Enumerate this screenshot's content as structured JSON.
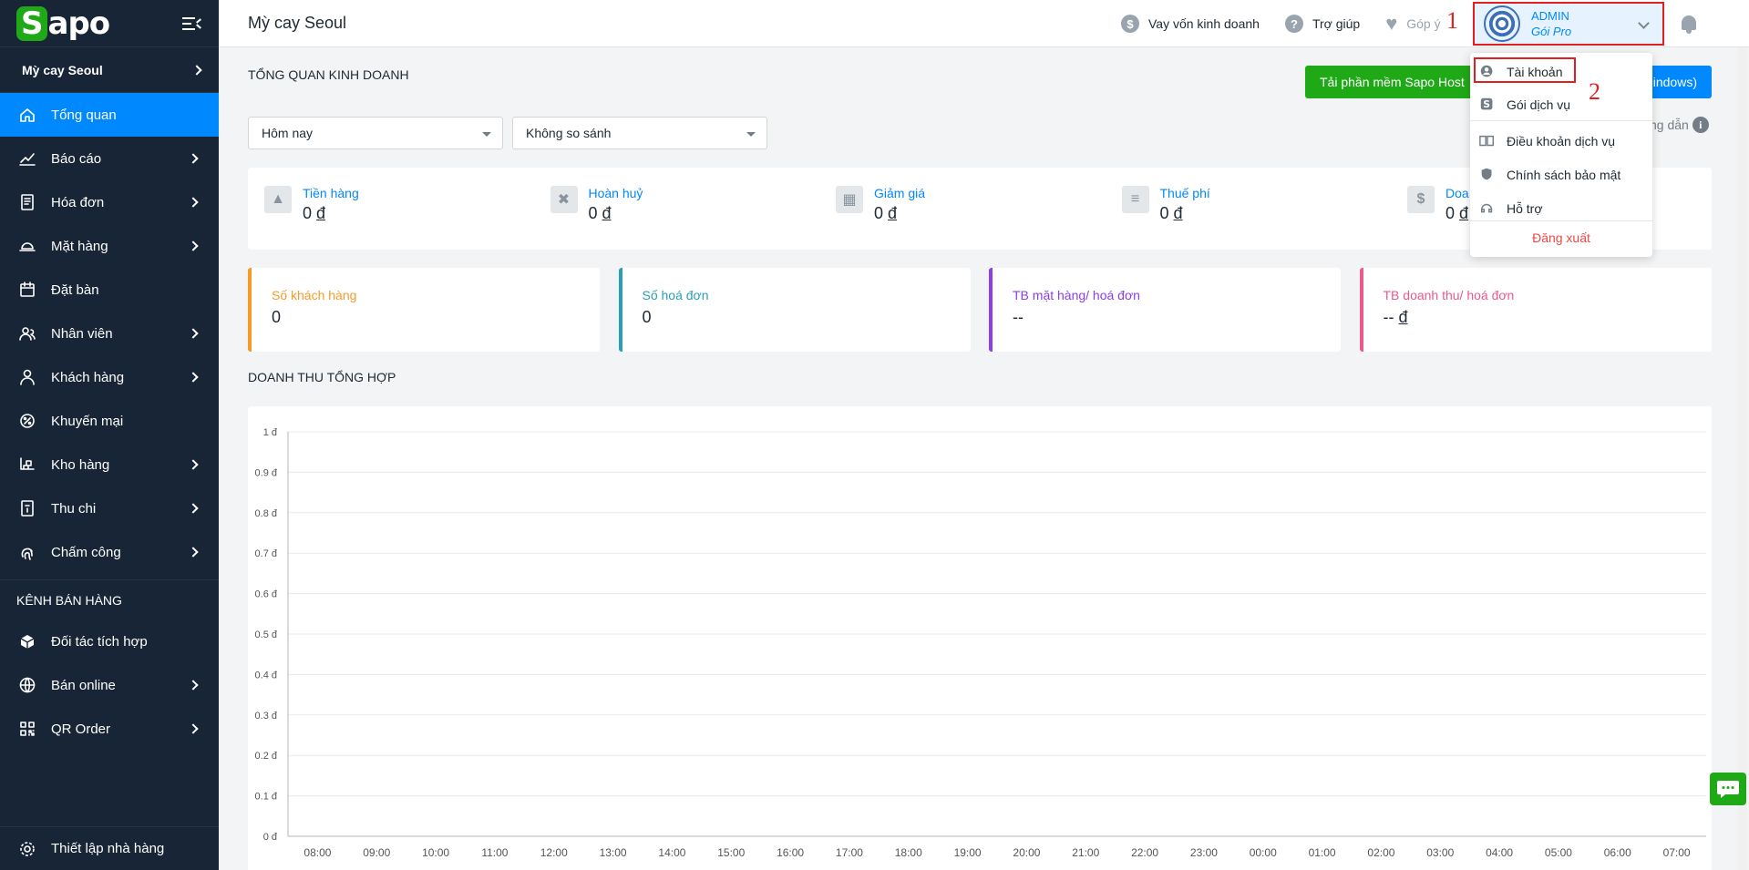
{
  "brand": {
    "logo_letter": "S",
    "logo_rest": "apo"
  },
  "sidebar": {
    "store": "Mỳ cay Seoul",
    "items": [
      {
        "label": "Tổng quan",
        "icon": "home-icon",
        "active": true,
        "arrow": false
      },
      {
        "label": "Báo cáo",
        "icon": "chart-line-icon",
        "arrow": true
      },
      {
        "label": "Hóa đơn",
        "icon": "receipt-icon",
        "arrow": true
      },
      {
        "label": "Mặt hàng",
        "icon": "dish-icon",
        "arrow": true
      },
      {
        "label": "Đặt bàn",
        "icon": "calendar-icon",
        "arrow": false
      },
      {
        "label": "Nhân viên",
        "icon": "staff-icon",
        "arrow": true
      },
      {
        "label": "Khách hàng",
        "icon": "customer-icon",
        "arrow": true
      },
      {
        "label": "Khuyến mại",
        "icon": "promotion-icon",
        "arrow": false
      },
      {
        "label": "Kho hàng",
        "icon": "warehouse-icon",
        "arrow": true
      },
      {
        "label": "Thu chi",
        "icon": "cashbook-icon",
        "arrow": true
      },
      {
        "label": "Chấm công",
        "icon": "fingerprint-icon",
        "arrow": true
      }
    ],
    "section_label": "KÊNH BÁN HÀNG",
    "channel_items": [
      {
        "label": "Đối tác tích hợp",
        "icon": "partner-icon",
        "arrow": false
      },
      {
        "label": "Bán online",
        "icon": "globe-icon",
        "arrow": true
      },
      {
        "label": "QR Order",
        "icon": "qr-icon",
        "arrow": true
      }
    ],
    "bottom": "Thiết lập nhà hàng"
  },
  "topbar": {
    "store": "Mỳ cay Seoul",
    "loan": "Vay vốn kinh doanh",
    "help": "Trợ giúp",
    "feedback": "Góp ý",
    "admin_name": "ADMIN",
    "admin_plan": "Gói Pro"
  },
  "annotations": {
    "marker1": "1",
    "marker2": "2"
  },
  "main": {
    "overview_title": "TỔNG QUAN KINH DOANH",
    "download_btn": "Tải phần mềm Sapo Host",
    "download_btn2": "indows)",
    "guide": "ng dẫn",
    "period": "Hôm nay",
    "compare": "Không so sánh",
    "stats": [
      {
        "label": "Tiền hàng",
        "value": "0",
        "icon": "tray-icon"
      },
      {
        "label": "Hoàn huỷ",
        "value": "0",
        "icon": "trash-icon"
      },
      {
        "label": "Giảm giá",
        "value": "0",
        "icon": "gift-icon"
      },
      {
        "label": "Thuế phí",
        "value": "0",
        "icon": "tax-icon"
      },
      {
        "label": "Doa",
        "value": "0",
        "icon": "dollar-icon"
      }
    ],
    "currency": "đ",
    "kpis": [
      {
        "label": "Số khách hàng",
        "value": "0",
        "color": "#f59b27"
      },
      {
        "label": "Số hoá đơn",
        "value": "0",
        "color": "#29a0b7"
      },
      {
        "label": "TB mặt hàng/ hoá đơn",
        "value": "--",
        "color": "#8c3fe6"
      },
      {
        "label": "TB doanh thu/ hoá đơn",
        "value": "--",
        "color": "#ec5a8c"
      }
    ],
    "revenue_title": "DOANH THU TỔNG HỢP"
  },
  "dropdown": {
    "items": [
      {
        "label": "Tài khoản",
        "icon": "user-circle-icon"
      },
      {
        "label": "Gói dịch vụ",
        "icon": "sapo-s-icon"
      },
      {
        "label": "Điều khoản dịch vụ",
        "icon": "book-icon"
      },
      {
        "label": "Chính sách bảo mật",
        "icon": "shield-icon"
      },
      {
        "label": "Hỗ trợ",
        "icon": "headset-icon"
      }
    ],
    "logout": "Đăng xuất"
  },
  "chart_data": {
    "type": "line",
    "title": "DOANH THU TỔNG HỢP",
    "x": [
      "08:00",
      "09:00",
      "10:00",
      "11:00",
      "12:00",
      "13:00",
      "14:00",
      "15:00",
      "16:00",
      "17:00",
      "18:00",
      "19:00",
      "20:00",
      "21:00",
      "22:00",
      "23:00",
      "00:00",
      "01:00",
      "02:00",
      "03:00",
      "04:00",
      "05:00",
      "06:00",
      "07:00"
    ],
    "y_ticks": [
      "0 đ",
      "0.1 đ",
      "0.2 đ",
      "0.3 đ",
      "0.4 đ",
      "0.5 đ",
      "0.6 đ",
      "0.7 đ",
      "0.8 đ",
      "0.9 đ",
      "1 đ"
    ],
    "ylim": [
      0,
      1
    ],
    "grid": true,
    "series": []
  }
}
